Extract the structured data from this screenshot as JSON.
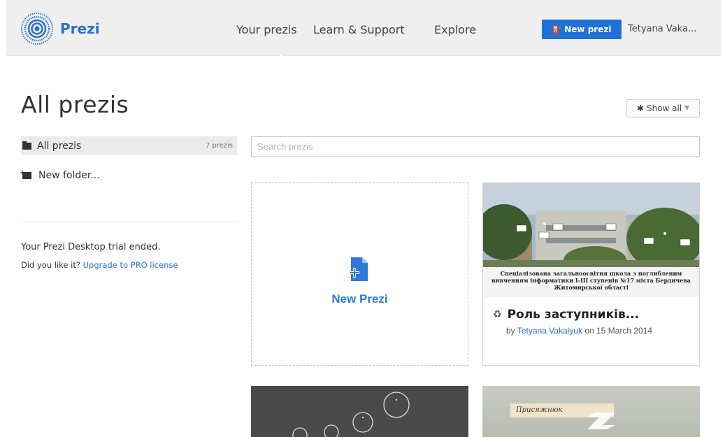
{
  "header": {
    "logo_text": "Prezi",
    "nav": [
      "Your prezis",
      "Learn & Support",
      "Explore"
    ],
    "new_prezi_label": "New prezi",
    "username": "Tetyana Vaka..."
  },
  "page": {
    "title": "All prezis",
    "show_all_label": "Show all"
  },
  "sidebar": {
    "all_label": "All prezis",
    "all_count": "7 prezis",
    "new_folder_label": "New folder...",
    "trial_line1": "Your Prezi Desktop trial ended.",
    "trial_question": "Did you like it?",
    "trial_link": "Upgrade to PRO license"
  },
  "search": {
    "placeholder": "Search prezis"
  },
  "new_tile": {
    "label": "New Prezi"
  },
  "prezis": [
    {
      "title": "Роль заступників...",
      "by": "by",
      "author": "Tetyana Vakalyuk",
      "date_text": "on 15 March 2014",
      "thumb_caption": "Спеціалізована загальноосвітня школа з поглибленим вивченням інформатики І-ІІІ ступенів №17 міста Бердичева Житомирської області"
    },
    {
      "title": "",
      "thumb_caption": ""
    },
    {
      "title": "",
      "thumb_caption": "Присяжнюк"
    }
  ],
  "colors": {
    "accent": "#1f71d6",
    "link": "#2a6fc9",
    "topbar_bg": "#efefef"
  }
}
